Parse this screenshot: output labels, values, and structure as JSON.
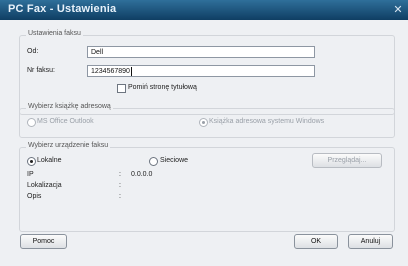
{
  "window": {
    "title": "PC Fax - Ustawienia"
  },
  "fax_settings": {
    "legend": "Ustawienia faksu",
    "from_label": "Od:",
    "from_value": "Dell",
    "fax_number_label": "Nr faksu:",
    "fax_number_value": "1234567890",
    "skip_cover_label": "Pomiń stronę tytułową",
    "skip_cover_checked": false
  },
  "address_book": {
    "legend": "Wybierz książkę adresową",
    "options": [
      {
        "label": "MS Office Outlook",
        "selected": false,
        "enabled": false
      },
      {
        "label": "Książka adresowa systemu Windows",
        "selected": true,
        "enabled": false
      }
    ]
  },
  "device": {
    "legend": "Wybierz urządzenie faksu",
    "options": [
      {
        "label": "Lokalne",
        "selected": true
      },
      {
        "label": "Sieciowe",
        "selected": false
      }
    ],
    "browse_label": "Przeglądaj...",
    "info": [
      {
        "label": "IP",
        "sep": ":",
        "value": "0.0.0.0"
      },
      {
        "label": "Lokalizacja",
        "sep": ":",
        "value": ""
      },
      {
        "label": "Opis",
        "sep": ":",
        "value": ""
      }
    ]
  },
  "buttons": {
    "help": "Pomoc",
    "ok": "OK",
    "cancel": "Anuluj"
  }
}
